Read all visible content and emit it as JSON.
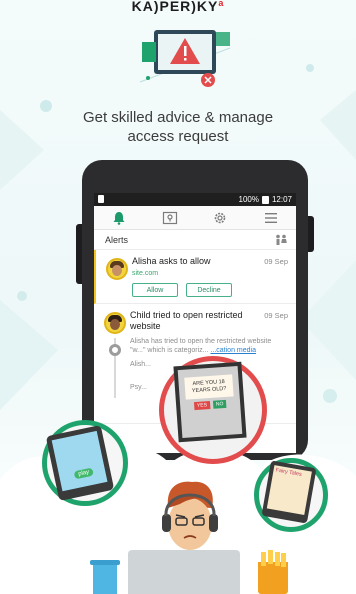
{
  "brand": {
    "name": "KA)PER)KY",
    "mark": "a"
  },
  "headline": {
    "line1": "Get skilled advice & manage",
    "line2": "access request"
  },
  "statusbar": {
    "battery": "100%",
    "time": "12:07"
  },
  "nav": {
    "items": [
      {
        "icon": "bell-icon",
        "active": true
      },
      {
        "icon": "map-icon",
        "active": false
      },
      {
        "icon": "gear-icon",
        "active": false
      },
      {
        "icon": "menu-icon",
        "active": false
      }
    ]
  },
  "alerts": {
    "title": "Alerts",
    "items": [
      {
        "title": "Alisha asks to allow",
        "time": "09 Sep",
        "sub": "site.com",
        "allow_label": "Allow",
        "decline_label": "Decline"
      },
      {
        "title": "Child tried to open restricted website",
        "time": "09 Sep",
        "detail": "Alisha has tried to open the restricted website \"w...\" which is categoriz...",
        "link": "...cation media",
        "extra": "Alish...",
        "extra2": "Psy..."
      }
    ]
  },
  "overlay": {
    "question": "ARE YOU 18 YEARS OLD?",
    "yes": "YES",
    "no": "NO",
    "play_label": "play",
    "fairy_label": "Fairy Tales"
  },
  "colors": {
    "accent": "#1d9a6c",
    "alert": "#e24c4c",
    "highlight": "#f3c31f"
  }
}
